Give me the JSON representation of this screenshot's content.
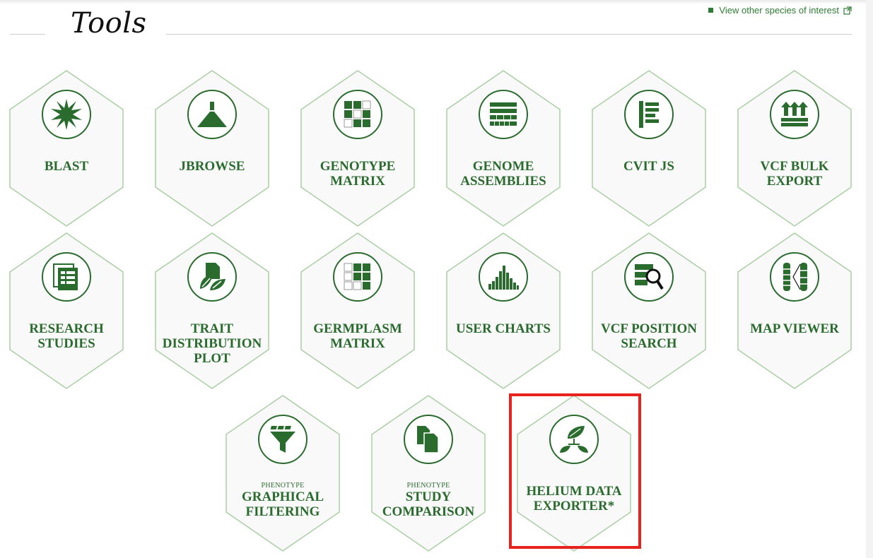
{
  "page": {
    "title": "Tools",
    "species_link": "View other species of interest"
  },
  "tiles": [
    {
      "line1": "BLAST",
      "line2": "",
      "line3": "",
      "sub": "",
      "icon": "blast-icon"
    },
    {
      "line1": "JBROWSE",
      "line2": "",
      "line3": "",
      "sub": "",
      "icon": "jbrowse-icon"
    },
    {
      "line1": "GENOTYPE",
      "line2": "MATRIX",
      "line3": "",
      "sub": "",
      "icon": "genotype-matrix-icon"
    },
    {
      "line1": "GENOME",
      "line2": "ASSEMBLIES",
      "line3": "",
      "sub": "",
      "icon": "genome-assemblies-icon"
    },
    {
      "line1": "CVIT JS",
      "line2": "",
      "line3": "",
      "sub": "",
      "icon": "cvit-icon"
    },
    {
      "line1": "VCF BULK",
      "line2": "EXPORT",
      "line3": "",
      "sub": "",
      "icon": "vcf-export-icon"
    },
    {
      "line1": "RESEARCH",
      "line2": "STUDIES",
      "line3": "",
      "sub": "",
      "icon": "research-studies-icon"
    },
    {
      "line1": "TRAIT",
      "line2": "DISTRIBUTION",
      "line3": "PLOT",
      "sub": "",
      "icon": "trait-distribution-icon"
    },
    {
      "line1": "GERMPLASM",
      "line2": "MATRIX",
      "line3": "",
      "sub": "",
      "icon": "germplasm-matrix-icon"
    },
    {
      "line1": "USER CHARTS",
      "line2": "",
      "line3": "",
      "sub": "",
      "icon": "user-charts-icon"
    },
    {
      "line1": "VCF POSITION",
      "line2": "SEARCH",
      "line3": "",
      "sub": "",
      "icon": "vcf-position-search-icon"
    },
    {
      "line1": "MAP VIEWER",
      "line2": "",
      "line3": "",
      "sub": "",
      "icon": "map-viewer-icon"
    },
    {
      "line1": "GRAPHICAL",
      "line2": "FILTERING",
      "line3": "",
      "sub": "PHENOTYPE",
      "icon": "filter-funnel-icon"
    },
    {
      "line1": "STUDY",
      "line2": "COMPARISON",
      "line3": "",
      "sub": "PHENOTYPE",
      "icon": "study-comparison-icon"
    },
    {
      "line1": "HELIUM DATA",
      "line2": "EXPORTER*",
      "line3": "",
      "sub": "",
      "icon": "helium-leaf-icon"
    }
  ],
  "colors": {
    "accent": "#2a6b2e",
    "hex_border": "#a9cfa3",
    "hex_fill": "#f9f9f9",
    "highlight": "#e8231e"
  }
}
